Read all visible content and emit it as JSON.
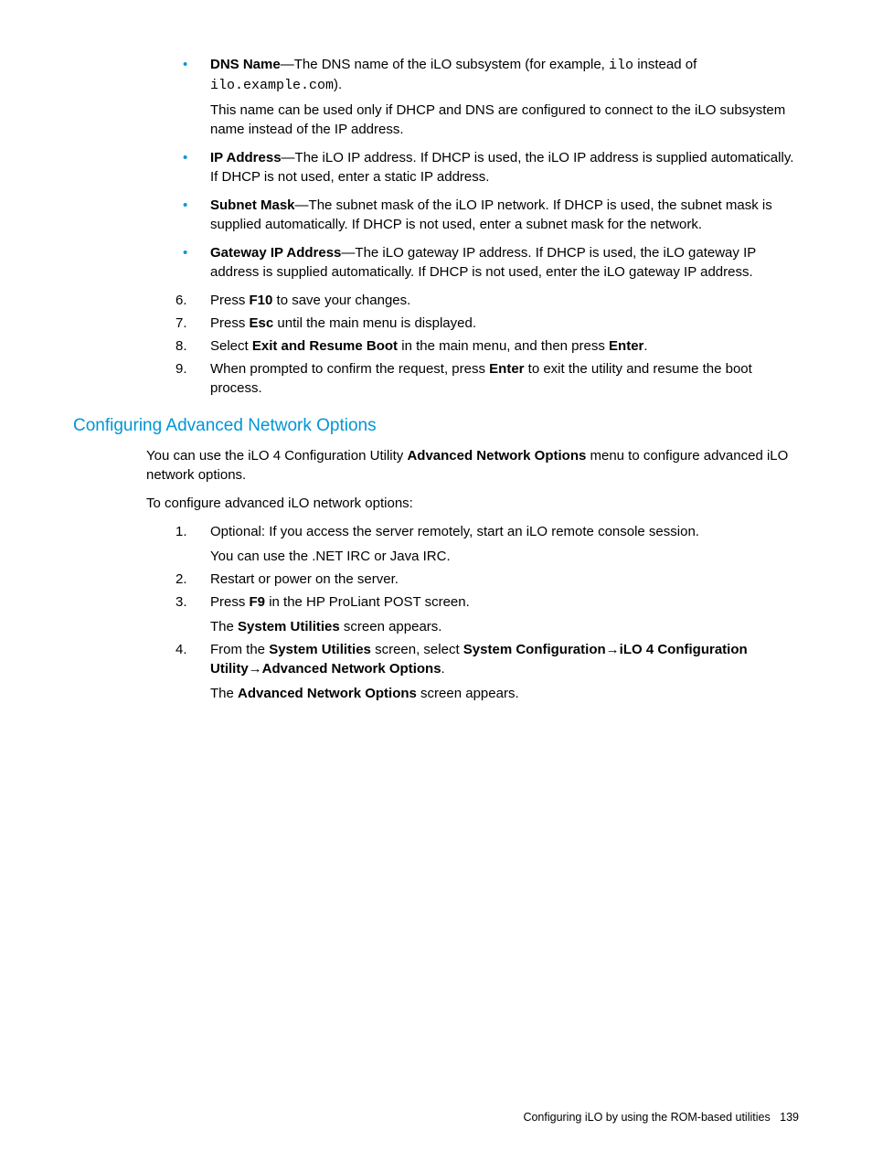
{
  "bullets": [
    {
      "term": "DNS Name",
      "text_before_code1": "—The DNS name of the iLO subsystem (for example, ",
      "code1": "ilo",
      "text_mid": " instead of ",
      "code2": "ilo.example.com",
      "text_after": ").",
      "sub": "This name can be used only if DHCP and DNS are configured to connect to the iLO subsystem name instead of the IP address."
    },
    {
      "term": "IP Address",
      "text": "—The iLO IP address. If DHCP is used, the iLO IP address is supplied automatically. If DHCP is not used, enter a static IP address."
    },
    {
      "term": "Subnet Mask",
      "text": "—The subnet mask of the iLO IP network. If DHCP is used, the subnet mask is supplied automatically. If DHCP is not used, enter a subnet mask for the network."
    },
    {
      "term": "Gateway IP Address",
      "text": "—The iLO gateway IP address. If DHCP is used, the iLO gateway IP address is supplied automatically. If DHCP is not used, enter the iLO gateway IP address."
    }
  ],
  "steps_a": {
    "s6": {
      "pre": "Press ",
      "b": "F10",
      "post": " to save your changes."
    },
    "s7": {
      "pre": "Press ",
      "b": "Esc",
      "post": " until the main menu is displayed."
    },
    "s8": {
      "pre": "Select ",
      "b1": "Exit and Resume Boot",
      "mid": " in the main menu, and then press ",
      "b2": "Enter",
      "post": "."
    },
    "s9": {
      "pre": "When prompted to confirm the request, press ",
      "b": "Enter",
      "post": " to exit the utility and resume the boot process."
    }
  },
  "heading": "Configuring Advanced Network Options",
  "intro": {
    "p1_pre": "You can use the iLO 4 Configuration Utility ",
    "p1_b": "Advanced Network Options",
    "p1_post": " menu to configure advanced iLO network options.",
    "p2": "To configure advanced iLO network options:"
  },
  "steps_b": {
    "s1": {
      "line": "Optional: If you access the server remotely, start an iLO remote console session.",
      "sub": "You can use the .NET IRC or Java IRC."
    },
    "s2": {
      "line": "Restart or power on the server."
    },
    "s3": {
      "pre": "Press ",
      "b": "F9",
      "post": " in the HP ProLiant POST screen.",
      "sub_pre": "The ",
      "sub_b": "System Utilities",
      "sub_post": " screen appears."
    },
    "s4": {
      "pre": "From the ",
      "b1": "System Utilities",
      "mid1": " screen, select ",
      "b2": "System Configuration",
      "arrow1": "→",
      "b3": "iLO 4 Configuration Utility",
      "arrow2": "→",
      "b4": "Advanced Network Options",
      "post": ".",
      "sub_pre": "The ",
      "sub_b": "Advanced Network Options",
      "sub_post": " screen appears."
    }
  },
  "footer": {
    "text": "Configuring iLO by using the ROM-based utilities",
    "page": "139"
  }
}
